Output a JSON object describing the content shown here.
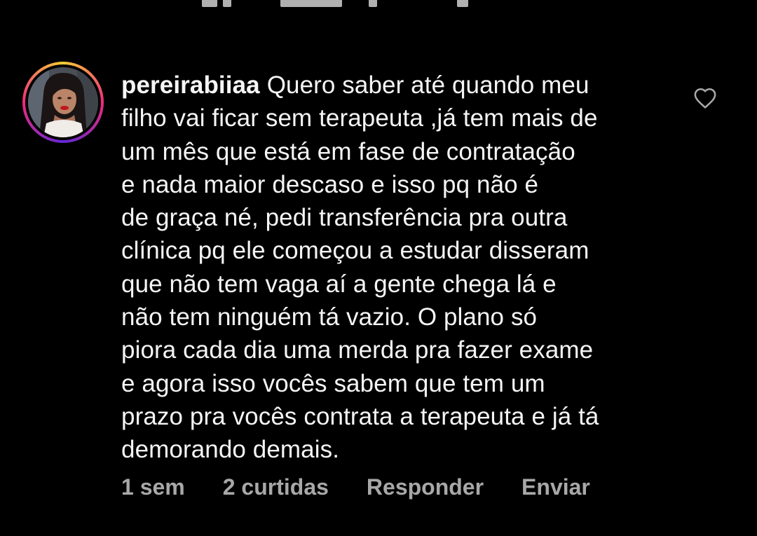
{
  "comment": {
    "username": "pereirabiiaa",
    "text": "Quero saber até quando meu\nfilho vai ficar sem terapeuta ,já tem mais de\num mês que está em fase de contratação\ne nada maior descaso e isso pq não é\nde graça né, pedi transferência pra outra\nclínica pq ele começou a estudar disseram\nque não tem vaga aí a gente chega lá e\nnão tem ninguém tá vazio. O plano só\npiora cada dia uma merda pra fazer exame\ne agora isso vocês sabem que tem um\nprazo pra vocês contrata a terapeuta e já tá\ndemorando demais.",
    "time": "1 sem",
    "likes": "2 curtidas",
    "reply_label": "Responder",
    "send_label": "Enviar",
    "avatar_icon": "profile-photo",
    "like_icon": "heart-outline-icon"
  },
  "colors": {
    "background": "#000000",
    "text": "#f5f5f5",
    "meta": "#a8a8a8",
    "story_ring": [
      "#f9ce34",
      "#ee2a7b",
      "#6228d7"
    ]
  }
}
